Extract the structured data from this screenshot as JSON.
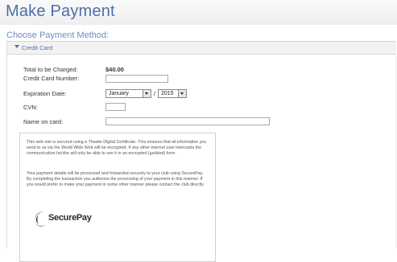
{
  "page": {
    "title": "Make Payment",
    "section_title": "Choose Payment Method:"
  },
  "panel": {
    "label": "Credit Card",
    "toggle_icon": "caret-down-icon"
  },
  "form": {
    "total_label": "Total to be Charged:",
    "total_value": "$40.00",
    "card_number_label": "Credit Card Number:",
    "card_number_value": "",
    "expiration_label": "Expiration Date:",
    "expiration_month": "January",
    "expiration_separator": "/",
    "expiration_year": "2015",
    "cvn_label": "CVN:",
    "cvn_value": "",
    "name_label": "Name on card:",
    "name_value": ""
  },
  "notice": {
    "paragraph1": "This web site is secured using a Thawte Digital Certificate. This ensures that all information you send to us via the World Wide Web will be encrypted. If any other internet user intercepts the communication he/she will only be able to see it in an encrypted (garbled) form.",
    "paragraph2": "Your payment details will be processed and forwarded securely to your club using SecurePay. By completing the transaction you authorise the processing of your payment in this manner. If you would prefer to make your payment in some other manner please contact the club directly.",
    "logo_text": "SecurePay",
    "logo_icon": "securepay-logo-icon"
  },
  "colors": {
    "accent": "#4d6fa8",
    "subtitle": "#6f8ec4",
    "header_bg": "#f2f2f2"
  }
}
